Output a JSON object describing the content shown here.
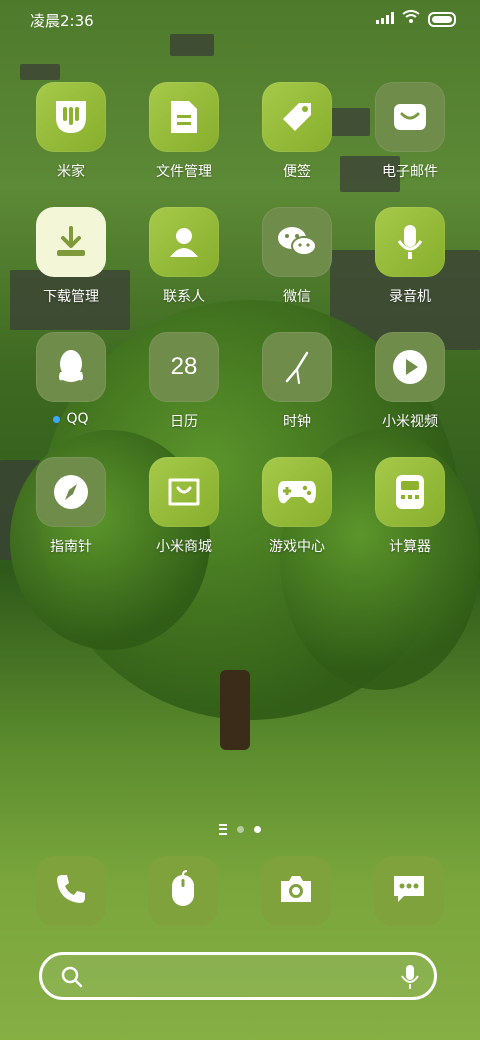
{
  "status": {
    "time": "凌晨2:36"
  },
  "apps": [
    {
      "label": "米家",
      "icon": "mi-home-icon",
      "style": "green"
    },
    {
      "label": "文件管理",
      "icon": "file-icon",
      "style": "green"
    },
    {
      "label": "便签",
      "icon": "tag-icon",
      "style": "green"
    },
    {
      "label": "电子邮件",
      "icon": "mail-icon",
      "style": "green"
    },
    {
      "label": "下载管理",
      "icon": "download-icon",
      "style": "white"
    },
    {
      "label": "联系人",
      "icon": "person-icon",
      "style": "green"
    },
    {
      "label": "微信",
      "icon": "wechat-icon",
      "style": "gray"
    },
    {
      "label": "录音机",
      "icon": "microphone-icon",
      "style": "green"
    },
    {
      "label": "QQ",
      "icon": "qq-icon",
      "style": "gray",
      "notification_dot": true
    },
    {
      "label": "日历",
      "icon": "calendar-icon",
      "style": "gray",
      "icon_text": "28"
    },
    {
      "label": "时钟",
      "icon": "clock-icon",
      "style": "gray"
    },
    {
      "label": "小米视频",
      "icon": "play-icon",
      "style": "gray"
    },
    {
      "label": "指南针",
      "icon": "compass-icon",
      "style": "gray"
    },
    {
      "label": "小米商城",
      "icon": "shopping-bag-icon",
      "style": "green"
    },
    {
      "label": "游戏中心",
      "icon": "gamepad-icon",
      "style": "green"
    },
    {
      "label": "计算器",
      "icon": "calculator-icon",
      "style": "green"
    }
  ],
  "dock": [
    {
      "icon": "phone-icon"
    },
    {
      "icon": "mouse-icon"
    },
    {
      "icon": "camera-icon"
    },
    {
      "icon": "message-icon"
    }
  ],
  "search": {
    "placeholder": ""
  },
  "pager": {
    "pages": 2,
    "active": 2
  }
}
